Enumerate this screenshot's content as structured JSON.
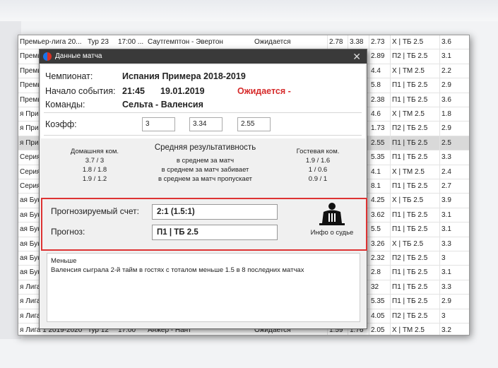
{
  "background_rows": [
    {
      "league": "Премьер-лига 20...",
      "tour": "Тур 23",
      "time": "17:00 ...",
      "teams": "Саутгемптон - Эвертон",
      "status": "Ожидается",
      "k1": "2.78",
      "k2": "3.38",
      "k3": "2.73",
      "pred": "X | ТБ 2.5",
      "val": "3.6"
    },
    {
      "league": "Премь",
      "k3": "2.89",
      "pred": "П2 | ТБ 2.5",
      "val": "3.1"
    },
    {
      "league": "Премь",
      "k3": "4.4",
      "pred": "X | ТМ 2.5",
      "val": "2.2"
    },
    {
      "league": "Премь",
      "k3": "5.8",
      "pred": "П1 | ТБ 2.5",
      "val": "2.9"
    },
    {
      "league": "Премь",
      "k3": "2.38",
      "pred": "П1 | ТБ 2.5",
      "val": "3.6"
    },
    {
      "league": "я Прим",
      "k3": "4.6",
      "pred": "X | ТМ 2.5",
      "val": "1.8"
    },
    {
      "league": "я Прим",
      "k3": "1.73",
      "pred": "П2 | ТБ 2.5",
      "val": "2.9"
    },
    {
      "league": "я Прим",
      "k3": "2.55",
      "pred": "П1 | ТБ 2.5",
      "val": "2.5",
      "highlight": true
    },
    {
      "league": "Серия",
      "k3": "5.35",
      "pred": "П1 | ТБ 2.5",
      "val": "3.3"
    },
    {
      "league": "Серия",
      "k3": "4.1",
      "pred": "X | ТМ 2.5",
      "val": "2.4"
    },
    {
      "league": "Серия",
      "k3": "8.1",
      "pred": "П1 | ТБ 2.5",
      "val": "2.7"
    },
    {
      "league": "ая Бун",
      "k3": "4.25",
      "pred": "X | ТБ 2.5",
      "val": "3.9"
    },
    {
      "league": "ая Бун",
      "k3": "3.62",
      "pred": "П1 | ТБ 2.5",
      "val": "3.1"
    },
    {
      "league": "ая Бун",
      "k3": "5.5",
      "pred": "П1 | ТБ 2.5",
      "val": "3.1"
    },
    {
      "league": "ая Бун",
      "k3": "3.26",
      "pred": "X | ТБ 2.5",
      "val": "3.3"
    },
    {
      "league": "ая Бун",
      "k3": "2.32",
      "pred": "П2 | ТБ 2.5",
      "val": "3"
    },
    {
      "league": "ая Бун",
      "k3": "2.8",
      "pred": "П1 | ТБ 2.5",
      "val": "3.1"
    },
    {
      "league": "я Лига",
      "k3": "32",
      "pred": "П1 | ТБ 2.5",
      "val": "3.3"
    },
    {
      "league": "я Лига",
      "k3": "5.35",
      "pred": "П1 | ТБ 2.5",
      "val": "2.9"
    },
    {
      "league": "я Лига",
      "k3": "4.05",
      "pred": "П2 | ТБ 2.5",
      "val": "3"
    },
    {
      "league": "я Лига 1 2019-2020",
      "tour": "Тур 12",
      "time": "17:00",
      "teams": "Анжер - Нант",
      "status": "Ожидается",
      "k1": "1.59",
      "k2": "1.76",
      "k3": "2.05",
      "pred": "X | ТМ 2.5",
      "val": "3.2"
    }
  ],
  "dialog": {
    "title": "Данные матча",
    "close": "✕",
    "championship_label": "Чемпионат:",
    "championship": "Испания Примера 2018-2019",
    "start_label": "Начало события:",
    "start_time": "21:45",
    "start_date": "19.01.2019",
    "status": "Ожидается -",
    "teams_label": "Команды:",
    "teams": "Сельта - Валенсия",
    "koef_label": "Коэфф:",
    "koef": [
      "3",
      "3.34",
      "2.55"
    ],
    "stats": {
      "home_title": "Домашняя ком.",
      "home": [
        "3.7 / 3",
        "1.8 / 1.8",
        "1.9 / 1.2"
      ],
      "mid_title": "Средняя результативность",
      "mid": [
        "в среднем за матч",
        "в среднем за матч забивает",
        "в среднем за матч пропускает"
      ],
      "away_title": "Гостевая ком.",
      "away": [
        "1.9 / 1.6",
        "1 / 0.6",
        "0.9 / 1"
      ]
    },
    "predicted_score_label": "Прогнозируемый счет:",
    "predicted_score": "2:1 (1.5:1)",
    "forecast_label": "Прогноз:",
    "forecast": "П1 | ТБ 2.5",
    "referee_label": "Инфо о судье",
    "comment_title": "Меньше",
    "comment_text": "Валенсия сыграла 2-й тайм в гостях с тоталом меньше 1.5 в 8 последних матчах"
  },
  "colors": {
    "accent_red": "#d62a2a",
    "titlebar": "#3a3a3a",
    "highlight_row": "#d9d9d9"
  }
}
